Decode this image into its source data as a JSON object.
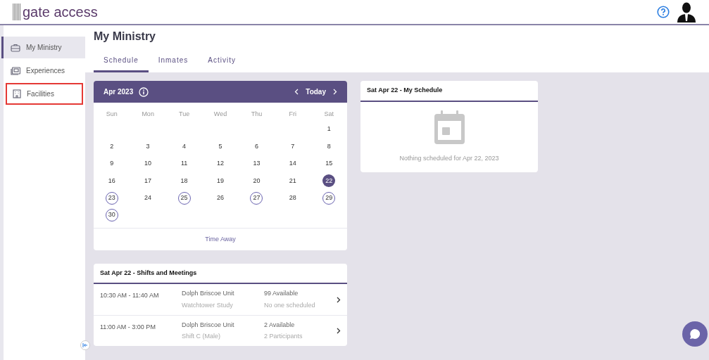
{
  "header": {
    "logo": "gate access"
  },
  "sidebar": {
    "items": [
      {
        "label": "My Ministry",
        "selected": true,
        "highlighted": false
      },
      {
        "label": "Experiences",
        "selected": false,
        "highlighted": false
      },
      {
        "label": "Facilities",
        "selected": false,
        "highlighted": true
      }
    ]
  },
  "page": {
    "title": "My Ministry",
    "tabs": [
      {
        "label": "Schedule",
        "selected": true
      },
      {
        "label": "Inmates",
        "selected": false
      },
      {
        "label": "Activity",
        "selected": false
      }
    ]
  },
  "calendar": {
    "month": "Apr 2023",
    "today": "Today",
    "weekdays": [
      "Sun",
      "Mon",
      "Tue",
      "Wed",
      "Thu",
      "Fri",
      "Sat"
    ],
    "weeks": [
      {
        "kind": "trailing",
        "days": [
          {
            "label": "1",
            "selected": false,
            "marked": false
          }
        ]
      },
      {
        "kind": "leading",
        "days": [
          {
            "label": "2",
            "selected": false,
            "marked": false
          },
          {
            "label": "3",
            "selected": false,
            "marked": false
          },
          {
            "label": "4",
            "selected": false,
            "marked": false
          },
          {
            "label": "5",
            "selected": false,
            "marked": false
          },
          {
            "label": "6",
            "selected": false,
            "marked": false
          },
          {
            "label": "7",
            "selected": false,
            "marked": false
          },
          {
            "label": "8",
            "selected": false,
            "marked": false
          }
        ]
      },
      {
        "kind": "leading",
        "days": [
          {
            "label": "9",
            "selected": false,
            "marked": false
          },
          {
            "label": "10",
            "selected": false,
            "marked": false
          },
          {
            "label": "11",
            "selected": false,
            "marked": false
          },
          {
            "label": "12",
            "selected": false,
            "marked": false
          },
          {
            "label": "13",
            "selected": false,
            "marked": false
          },
          {
            "label": "14",
            "selected": false,
            "marked": false
          },
          {
            "label": "15",
            "selected": false,
            "marked": false
          }
        ]
      },
      {
        "kind": "leading",
        "days": [
          {
            "label": "16",
            "selected": false,
            "marked": false
          },
          {
            "label": "17",
            "selected": false,
            "marked": false
          },
          {
            "label": "18",
            "selected": false,
            "marked": false
          },
          {
            "label": "19",
            "selected": false,
            "marked": false
          },
          {
            "label": "20",
            "selected": false,
            "marked": false
          },
          {
            "label": "21",
            "selected": false,
            "marked": false
          },
          {
            "label": "22",
            "selected": true,
            "marked": false
          }
        ]
      },
      {
        "kind": "leading",
        "days": [
          {
            "label": "23",
            "selected": false,
            "marked": true
          },
          {
            "label": "24",
            "selected": false,
            "marked": false
          },
          {
            "label": "25",
            "selected": false,
            "marked": true
          },
          {
            "label": "26",
            "selected": false,
            "marked": false
          },
          {
            "label": "27",
            "selected": false,
            "marked": true
          },
          {
            "label": "28",
            "selected": false,
            "marked": false
          },
          {
            "label": "29",
            "selected": false,
            "marked": true
          }
        ]
      },
      {
        "kind": "leading",
        "days": [
          {
            "label": "30",
            "selected": false,
            "marked": true
          }
        ]
      }
    ],
    "footer": "Time Away"
  },
  "shifts": {
    "title": "Sat Apr 22 - Shifts and Meetings",
    "rows": [
      {
        "time": "10:30 AM - 11:40 AM",
        "unit": "Dolph Briscoe Unit",
        "activity": "Watchtower Study",
        "available": "99 Available",
        "participants": "No one scheduled"
      },
      {
        "time": "11:00 AM - 3:00 PM",
        "unit": "Dolph Briscoe Unit",
        "activity": "Shift C (Male)",
        "available": "2 Available",
        "participants": "2 Participants"
      }
    ]
  },
  "my_schedule": {
    "title": "Sat Apr 22 - My Schedule",
    "empty_message": "Nothing scheduled for Apr 22, 2023"
  }
}
